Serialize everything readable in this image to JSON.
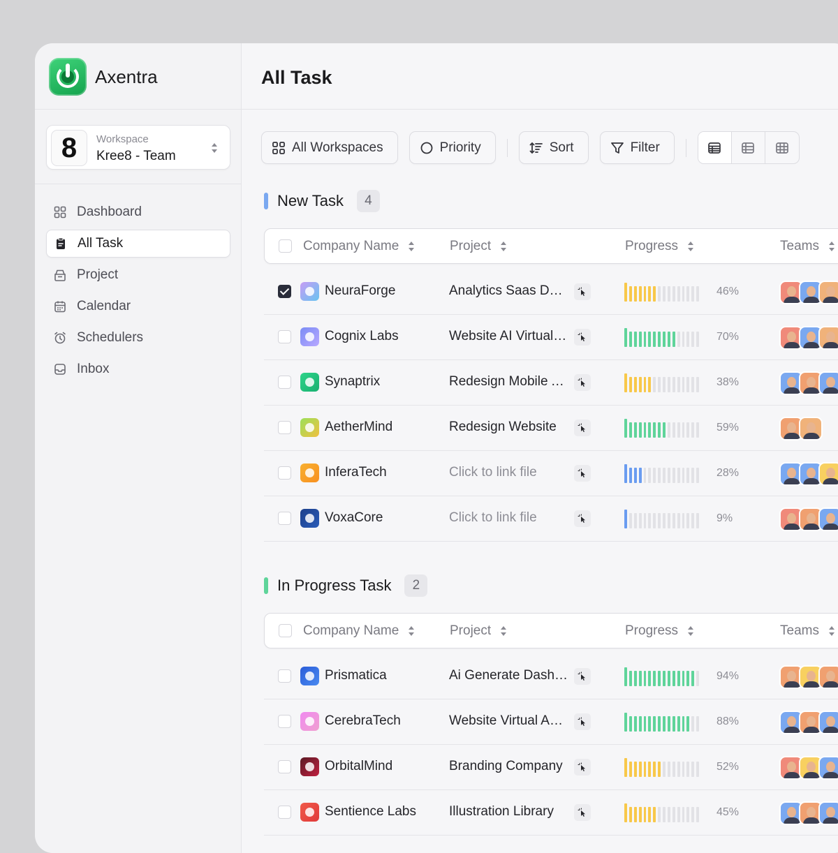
{
  "app": {
    "name": "Axentra"
  },
  "workspace": {
    "label": "Workspace",
    "name": "Kree8 - Team",
    "avatar_text": "8"
  },
  "nav": [
    {
      "label": "Dashboard",
      "icon": "grid-icon",
      "active": false
    },
    {
      "label": "All Task",
      "icon": "clipboard-icon",
      "active": true
    },
    {
      "label": "Project",
      "icon": "box-icon",
      "active": false
    },
    {
      "label": "Calendar",
      "icon": "calendar-icon",
      "active": false
    },
    {
      "label": "Schedulers",
      "icon": "alarm-icon",
      "active": false
    },
    {
      "label": "Inbox",
      "icon": "inbox-icon",
      "active": false
    }
  ],
  "page": {
    "title": "All Task"
  },
  "toolbar": {
    "workspaces": "All Workspaces",
    "priority": "Priority",
    "sort": "Sort",
    "filter": "Filter"
  },
  "columns": {
    "company": "Company Name",
    "project": "Project",
    "progress": "Progress",
    "teams": "Teams"
  },
  "sections": [
    {
      "title": "New Task",
      "count": "4",
      "accent": "#7aa8f0",
      "rows": [
        {
          "company": "NeuraForge",
          "project": "Analytics Saas Dashboard",
          "muted": false,
          "progress": 46,
          "progress_label": "46%",
          "color": "#f8c84a",
          "checked": true,
          "logo": [
            "#c79cf5",
            "#68c4f0"
          ],
          "team": [
            "#f08a7a",
            "#7aa8f0",
            "#f0b27a"
          ]
        },
        {
          "company": "Cognix Labs",
          "project": "Website AI Virtual Assistant",
          "muted": false,
          "progress": 70,
          "progress_label": "70%",
          "color": "#5fd49a",
          "checked": false,
          "logo": [
            "#7a8cf5",
            "#b8a8ff"
          ],
          "team": [
            "#f08a7a",
            "#7aa8f0",
            "#f0b27a"
          ]
        },
        {
          "company": "Synaptrix",
          "project": "Redesign Mobile App",
          "muted": false,
          "progress": 38,
          "progress_label": "38%",
          "color": "#f8c84a",
          "checked": false,
          "logo": [
            "#2fd48a",
            "#18b070"
          ],
          "team": [
            "#7aa8f0",
            "#f0a070",
            "#7aa8f0"
          ]
        },
        {
          "company": "AetherMind",
          "project": "Redesign Website",
          "muted": false,
          "progress": 59,
          "progress_label": "59%",
          "color": "#5fd49a",
          "checked": false,
          "logo": [
            "#9be05a",
            "#f0c040"
          ],
          "team": [
            "#f0a070",
            "#f0b27a"
          ]
        },
        {
          "company": "InferaTech",
          "project": "Click to link file",
          "muted": true,
          "progress": 28,
          "progress_label": "28%",
          "color": "#6a9cf0",
          "checked": false,
          "logo": [
            "#f8b030",
            "#f89020"
          ],
          "team": [
            "#7aa8f0",
            "#7aa8f0",
            "#f8d060"
          ]
        },
        {
          "company": "VoxaCore",
          "project": "Click to link file",
          "muted": true,
          "progress": 9,
          "progress_label": "9%",
          "color": "#6a9cf0",
          "checked": false,
          "logo": [
            "#1c3f8a",
            "#2a5cb8"
          ],
          "team": [
            "#f08a7a",
            "#f0a070",
            "#7aa8f0"
          ]
        }
      ]
    },
    {
      "title": "In Progress Task",
      "count": "2",
      "accent": "#5fd49a",
      "rows": [
        {
          "company": "Prismatica",
          "project": "Ai Generate Dashboard",
          "muted": false,
          "progress": 94,
          "progress_label": "94%",
          "color": "#5fd49a",
          "checked": false,
          "logo": [
            "#2a5cd8",
            "#4a8af0"
          ],
          "team": [
            "#f0a070",
            "#f8d060",
            "#f0a070"
          ]
        },
        {
          "company": "CerebraTech",
          "project": "Website Virtual Assistant",
          "muted": false,
          "progress": 88,
          "progress_label": "88%",
          "color": "#5fd49a",
          "checked": false,
          "logo": [
            "#f08af0",
            "#f0a0d0"
          ],
          "team": [
            "#7aa8f0",
            "#f0a070",
            "#7aa8f0"
          ]
        },
        {
          "company": "OrbitalMind",
          "project": "Branding Company",
          "muted": false,
          "progress": 52,
          "progress_label": "52%",
          "color": "#f8c84a",
          "checked": false,
          "logo": [
            "#5a1a24",
            "#c02040"
          ],
          "team": [
            "#f08a7a",
            "#f8d060",
            "#7aa8f0"
          ]
        },
        {
          "company": "Sentience Labs",
          "project": "Illustration Library",
          "muted": false,
          "progress": 45,
          "progress_label": "45%",
          "color": "#f8c84a",
          "checked": false,
          "logo": [
            "#f05a4a",
            "#e03a3a"
          ],
          "team": [
            "#7aa8f0",
            "#f0a070",
            "#7aa8f0"
          ]
        }
      ]
    }
  ]
}
